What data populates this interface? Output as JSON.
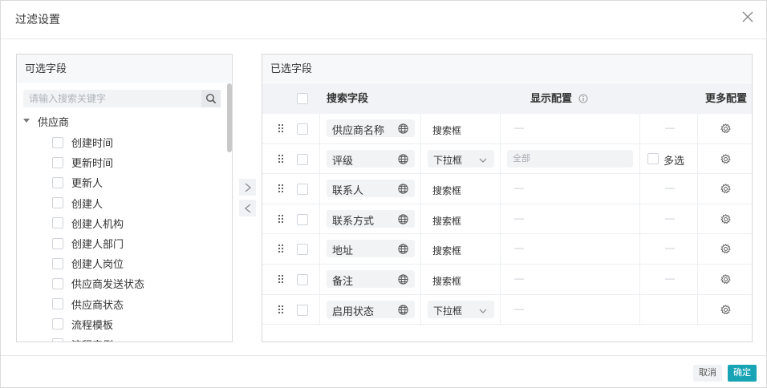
{
  "dialog": {
    "title": "过滤设置"
  },
  "available": {
    "header": "可选字段",
    "search_placeholder": "请输入搜索关键字",
    "group": "供应商",
    "fields": [
      "创建时间",
      "更新时间",
      "更新人",
      "创建人",
      "创建人机构",
      "创建人部门",
      "创建人岗位",
      "供应商发送状态",
      "供应商状态",
      "流程模板",
      "流程实例"
    ]
  },
  "selected": {
    "header": "已选字段",
    "columns": {
      "search_field": "搜索字段",
      "display_config": "显示配置",
      "more_config": "更多配置"
    },
    "rows": [
      {
        "name": "供应商名称",
        "control": "搜索框",
        "dropdown": false,
        "default": "—",
        "multi": "—"
      },
      {
        "name": "评级",
        "control": "下拉框",
        "dropdown": true,
        "default": "全部",
        "multi": "多选"
      },
      {
        "name": "联系人",
        "control": "搜索框",
        "dropdown": false,
        "default": "—",
        "multi": "—"
      },
      {
        "name": "联系方式",
        "control": "搜索框",
        "dropdown": false,
        "default": "—",
        "multi": "—"
      },
      {
        "name": "地址",
        "control": "搜索框",
        "dropdown": false,
        "default": "—",
        "multi": "—"
      },
      {
        "name": "备注",
        "control": "搜索框",
        "dropdown": false,
        "default": "—",
        "multi": "—"
      },
      {
        "name": "启用状态",
        "control": "下拉框",
        "dropdown": true,
        "default": "—",
        "multi": ""
      }
    ]
  },
  "footer": {
    "cancel": "取消",
    "ok": "确定"
  },
  "colors": {
    "primary": "#19a4b5",
    "header_bg": "#f1f3f6",
    "chip_bg": "#f1f3f5",
    "border": "#d9d9d9"
  },
  "icons": [
    "close-icon",
    "search-icon",
    "caret-down-icon",
    "chevron-right-icon",
    "chevron-left-icon",
    "info-icon",
    "drag-handle-icon",
    "globe-icon",
    "chevron-down-icon",
    "gear-icon"
  ]
}
